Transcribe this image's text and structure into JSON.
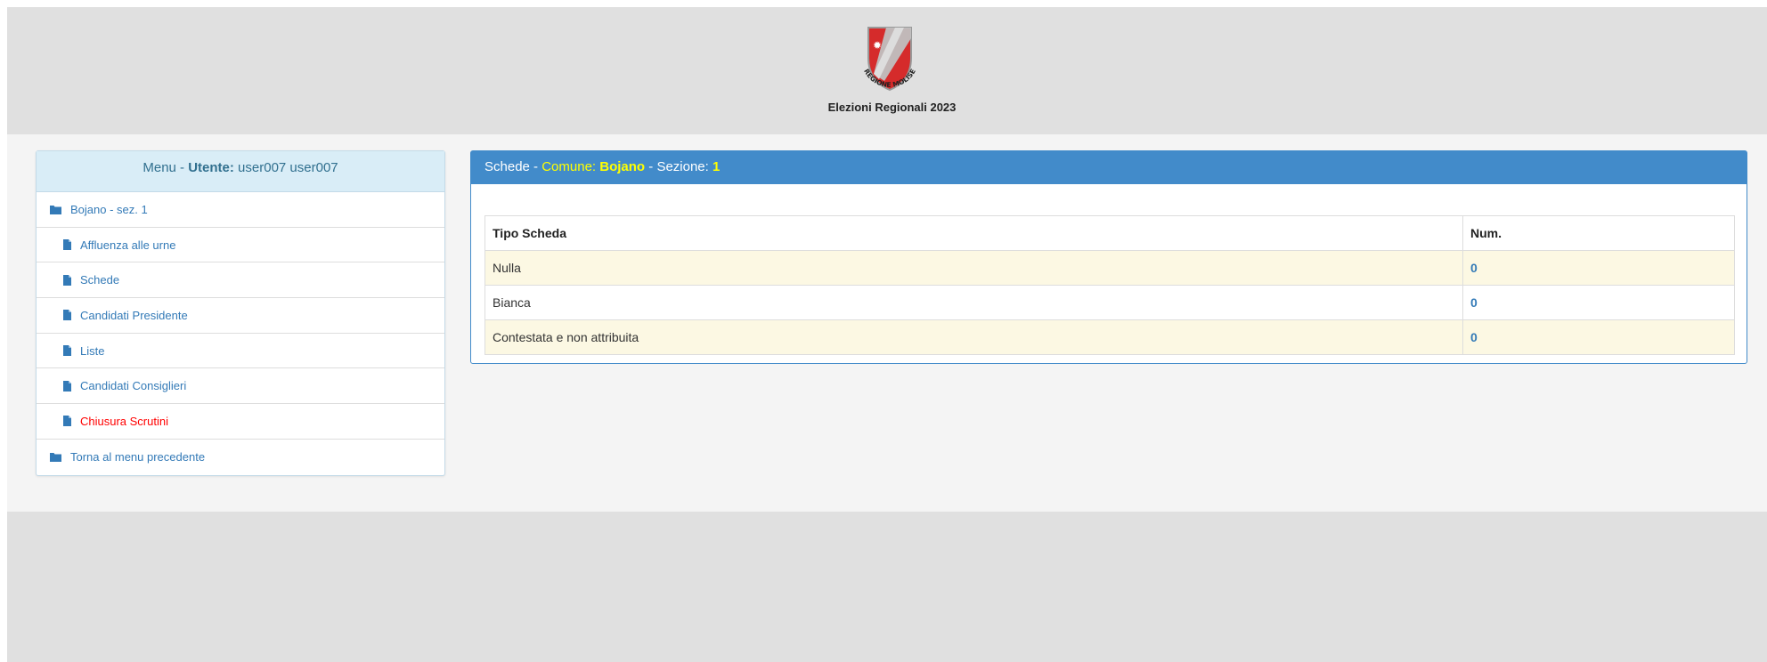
{
  "header": {
    "logo_text": "REGIONE MOLISE",
    "title": "Elezioni Regionali 2023"
  },
  "menu": {
    "head_prefix": "Menu - ",
    "user_label": "Utente:",
    "user_name": " user007 user007",
    "items": [
      {
        "label": "Bojano - sez. 1",
        "icon": "folder-icon"
      },
      {
        "label": "Affluenza alle urne",
        "icon": "file-icon"
      },
      {
        "label": "Schede",
        "icon": "file-icon"
      },
      {
        "label": "Candidati Presidente",
        "icon": "file-icon"
      },
      {
        "label": "Liste",
        "icon": "file-icon"
      },
      {
        "label": "Candidati Consiglieri",
        "icon": "file-icon"
      },
      {
        "label": "Chiusura Scrutini",
        "icon": "file-icon",
        "color": "#ff0000"
      },
      {
        "label": "Torna al menu precedente",
        "icon": "folder-icon"
      }
    ]
  },
  "panel": {
    "title_prefix": "Schede - ",
    "comune_label": "Comune: ",
    "comune_value": "Bojano",
    "sezione_label": " - Sezione: ",
    "sezione_value": "1",
    "table": {
      "headers": [
        "Tipo Scheda",
        "Num."
      ],
      "rows": [
        {
          "tipo": "Nulla",
          "num": "0"
        },
        {
          "tipo": "Bianca",
          "num": "0"
        },
        {
          "tipo": "Contestata e non attribuita",
          "num": "0"
        }
      ]
    }
  },
  "colors": {
    "panel_primary": "#428bca",
    "highlight_yellow": "#ffff00",
    "menu_head_bg": "#d9edf7",
    "link": "#337ab7",
    "danger": "#ff0000",
    "row_stripe": "#fcf8e3"
  }
}
